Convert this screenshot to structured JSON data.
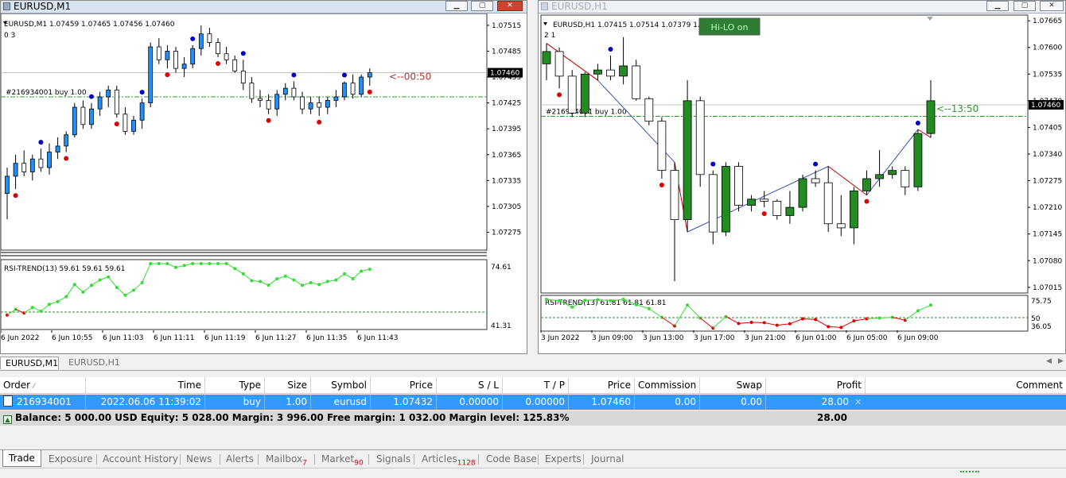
{
  "colors": {
    "bull_blue": "#1e90ff",
    "bull_green": "#228b22",
    "dot_red": "#e00000",
    "dot_blue": "#0000cc",
    "rsi_green": "#33dd33",
    "rsi_red": "#dd0000",
    "zigzag": "#b00000"
  },
  "chart1": {
    "window_title": "EURUSD,M1",
    "ohlc_line": "EURUSD,M1  1.07459 1.07465 1.07456 1.07460",
    "values_line": "0   3",
    "order_label": "#216934001 buy 1.00",
    "countdown": "<--00:50",
    "current_price": "1.07460",
    "price_ticks": [
      "1.07515",
      "1.07485",
      "1.07455",
      "1.07425",
      "1.07395",
      "1.07365",
      "1.07335",
      "1.07305",
      "1.07275"
    ],
    "indicator_label": "RSI-TREND(13) 59.61 59.61 59.61",
    "indicator_ticks": [
      "74.61",
      "41.31"
    ],
    "time_ticks": [
      "6 Jun 2022",
      "6 Jun 10:55",
      "6 Jun 11:03",
      "6 Jun 11:11",
      "6 Jun 11:19",
      "6 Jun 11:27",
      "6 Jun 11:35",
      "6 Jun 11:43"
    ]
  },
  "chart2": {
    "window_title": "EURUSD,H1",
    "ohlc_line": "EURUSD,H1  1.07415 1.07514 1.07379 1.07",
    "values_line": "2   1",
    "hilo_label": "Hi-LO on",
    "order_label": "#216934001 buy 1.00",
    "countdown": "<--13:50",
    "current_price": "1.07460",
    "price_ticks": [
      "1.07665",
      "1.07600",
      "1.07535",
      "1.07470",
      "1.07405",
      "1.07340",
      "1.07275",
      "1.07210",
      "1.07145",
      "1.07080",
      "1.07015"
    ],
    "indicator_label": "RSI-TREND(13) 61.81 61.81 61.81",
    "indicator_ticks": [
      "75.75",
      "50",
      "36.05"
    ],
    "time_ticks": [
      "3 Jun 2022",
      "3 Jun 09:00",
      "3 Jun 13:00",
      "3 Jun 17:00",
      "3 Jun 21:00",
      "6 Jun 01:00",
      "6 Jun 05:00",
      "6 Jun 09:00"
    ]
  },
  "chart_tabs": [
    {
      "label": "EURUSD,M1",
      "active": true
    },
    {
      "label": "EURUSD,H1",
      "active": false
    }
  ],
  "table": {
    "headers": [
      "Order",
      "Time",
      "Type",
      "Size",
      "Symbol",
      "Price",
      "S / L",
      "T / P",
      "Price",
      "Commission",
      "Swap",
      "Profit",
      "Comment"
    ],
    "row": [
      "216934001",
      "2022.06.06 11:39:02",
      "buy",
      "1.00",
      "eurusd",
      "1.07432",
      "0.00000",
      "0.00000",
      "1.07460",
      "0.00",
      "0.00",
      "28.00",
      ""
    ],
    "balance_text": "Balance: 5 000.00 USD  Equity: 5 028.00  Margin: 3 996.00  Free margin: 1 032.00  Margin level: 125.83%",
    "balance_profit": "28.00"
  },
  "bottom_tabs": [
    {
      "label": "Trade",
      "badge": ""
    },
    {
      "label": "Exposure",
      "badge": ""
    },
    {
      "label": "Account History",
      "badge": ""
    },
    {
      "label": "News",
      "badge": ""
    },
    {
      "label": "Alerts",
      "badge": ""
    },
    {
      "label": "Mailbox",
      "badge": "7"
    },
    {
      "label": "Market",
      "badge": "90"
    },
    {
      "label": "Signals",
      "badge": ""
    },
    {
      "label": "Articles",
      "badge": "1128"
    },
    {
      "label": "Code Base",
      "badge": ""
    },
    {
      "label": "Experts",
      "badge": ""
    },
    {
      "label": "Journal",
      "badge": ""
    }
  ],
  "chart_data": [
    {
      "type": "candlestick",
      "title": "EURUSD,M1",
      "ylim": [
        1.07258,
        1.07525
      ],
      "candles": [
        [
          1.0732,
          1.0735,
          1.0729,
          1.0734
        ],
        [
          1.0734,
          1.07365,
          1.07325,
          1.07355
        ],
        [
          1.07355,
          1.0737,
          1.0734,
          1.07345
        ],
        [
          1.07345,
          1.07365,
          1.07335,
          1.0736
        ],
        [
          1.0736,
          1.07372,
          1.07345,
          1.0735
        ],
        [
          1.0735,
          1.07378,
          1.07342,
          1.07368
        ],
        [
          1.07368,
          1.07385,
          1.0736,
          1.07375
        ],
        [
          1.07375,
          1.07392,
          1.07368,
          1.07388
        ],
        [
          1.07388,
          1.07425,
          1.07385,
          1.0742
        ],
        [
          1.0742,
          1.07428,
          1.07395,
          1.074
        ],
        [
          1.074,
          1.07425,
          1.07395,
          1.07418
        ],
        [
          1.07418,
          1.07438,
          1.0741,
          1.07432
        ],
        [
          1.07432,
          1.07445,
          1.0742,
          1.0744
        ],
        [
          1.0744,
          1.07445,
          1.07408,
          1.07412
        ],
        [
          1.07412,
          1.0742,
          1.07388,
          1.07392
        ],
        [
          1.07392,
          1.0741,
          1.07388,
          1.07405
        ],
        [
          1.07405,
          1.0743,
          1.07395,
          1.07425
        ],
        [
          1.07425,
          1.07495,
          1.0742,
          1.0749
        ],
        [
          1.0749,
          1.075,
          1.0747,
          1.07475
        ],
        [
          1.07475,
          1.07492,
          1.07465,
          1.07485
        ],
        [
          1.07485,
          1.0749,
          1.0746,
          1.07465
        ],
        [
          1.07465,
          1.07478,
          1.07455,
          1.0747
        ],
        [
          1.0747,
          1.07492,
          1.07465,
          1.07488
        ],
        [
          1.07488,
          1.07515,
          1.0748,
          1.07505
        ],
        [
          1.07505,
          1.07512,
          1.0749,
          1.07495
        ],
        [
          1.07495,
          1.075,
          1.07478,
          1.07482
        ],
        [
          1.07482,
          1.0749,
          1.0747,
          1.07475
        ],
        [
          1.07475,
          1.0748,
          1.0746,
          1.07462
        ],
        [
          1.07462,
          1.07475,
          1.0744,
          1.07448
        ],
        [
          1.07448,
          1.07455,
          1.07425,
          1.0743
        ],
        [
          1.0743,
          1.0744,
          1.0742,
          1.07428
        ],
        [
          1.07428,
          1.07435,
          1.07412,
          1.07418
        ],
        [
          1.07418,
          1.0744,
          1.0741,
          1.07435
        ],
        [
          1.07435,
          1.07448,
          1.07428,
          1.07442
        ],
        [
          1.07442,
          1.0745,
          1.07428,
          1.07432
        ],
        [
          1.07432,
          1.07438,
          1.07412,
          1.07418
        ],
        [
          1.07418,
          1.07432,
          1.07412,
          1.07425
        ],
        [
          1.07425,
          1.07432,
          1.0741,
          1.0742
        ],
        [
          1.0742,
          1.07432,
          1.07412,
          1.07428
        ],
        [
          1.07428,
          1.0744,
          1.0742,
          1.07432
        ],
        [
          1.07432,
          1.0745,
          1.07428,
          1.07448
        ],
        [
          1.07448,
          1.07458,
          1.0743,
          1.07435
        ],
        [
          1.07435,
          1.07458,
          1.07432,
          1.07455
        ],
        [
          1.07455,
          1.07465,
          1.07445,
          1.0746
        ]
      ]
    },
    {
      "type": "candlestick",
      "title": "EURUSD,H1",
      "ylim": [
        1.07005,
        1.07675
      ],
      "candles": [
        [
          1.0756,
          1.0761,
          1.0752,
          1.0759
        ],
        [
          1.0759,
          1.076,
          1.075,
          1.0753
        ],
        [
          1.0753,
          1.07545,
          1.0743,
          1.0744
        ],
        [
          1.0744,
          1.0754,
          1.0743,
          1.07535
        ],
        [
          1.07535,
          1.0756,
          1.0752,
          1.07545
        ],
        [
          1.07545,
          1.0758,
          1.0752,
          1.0753
        ],
        [
          1.0753,
          1.07625,
          1.0751,
          1.07555
        ],
        [
          1.07555,
          1.0757,
          1.0747,
          1.07475
        ],
        [
          1.07475,
          1.0748,
          1.0741,
          1.0742
        ],
        [
          1.0742,
          1.0743,
          1.0728,
          1.073
        ],
        [
          1.073,
          1.0732,
          1.0703,
          1.0718
        ],
        [
          1.0718,
          1.0752,
          1.0715,
          1.0747
        ],
        [
          1.0747,
          1.0748,
          1.0726,
          1.0729
        ],
        [
          1.0729,
          1.073,
          1.0712,
          1.0715
        ],
        [
          1.0715,
          1.0732,
          1.0714,
          1.0731
        ],
        [
          1.0731,
          1.0732,
          1.072,
          1.07215
        ],
        [
          1.07215,
          1.0724,
          1.072,
          1.0723
        ],
        [
          1.0723,
          1.0725,
          1.0721,
          1.07225
        ],
        [
          1.07225,
          1.0723,
          1.0718,
          1.0719
        ],
        [
          1.0719,
          1.0725,
          1.0717,
          1.0721
        ],
        [
          1.0721,
          1.0729,
          1.072,
          1.0728
        ],
        [
          1.0728,
          1.073,
          1.0726,
          1.0727
        ],
        [
          1.0727,
          1.0731,
          1.0715,
          1.0717
        ],
        [
          1.0717,
          1.0724,
          1.0714,
          1.0716
        ],
        [
          1.0716,
          1.0726,
          1.0712,
          1.0725
        ],
        [
          1.0725,
          1.073,
          1.0724,
          1.0728
        ],
        [
          1.0728,
          1.0735,
          1.0726,
          1.0729
        ],
        [
          1.0729,
          1.0731,
          1.0728,
          1.073
        ],
        [
          1.073,
          1.0731,
          1.0724,
          1.0726
        ],
        [
          1.0726,
          1.074,
          1.0725,
          1.0739
        ],
        [
          1.0739,
          1.0752,
          1.0738,
          1.0747
        ]
      ]
    }
  ]
}
